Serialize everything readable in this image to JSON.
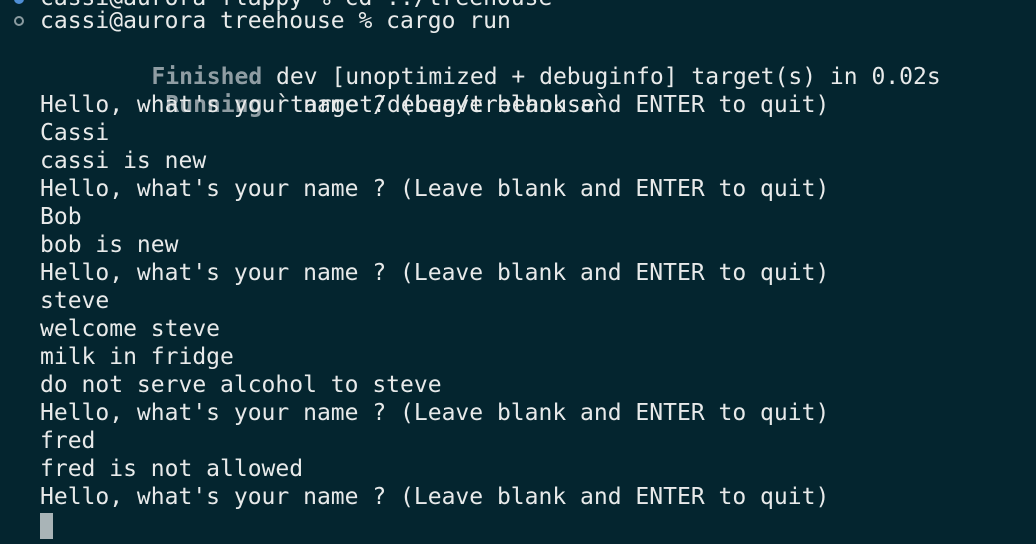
{
  "prompt_cut": {
    "text": "cassi@aurora flappy % cd ../treehouse"
  },
  "prompt": {
    "text": "cassi@aurora treehouse % cargo run"
  },
  "build": {
    "finished_status": "Finished",
    "finished_detail": " dev [unoptimized + debuginfo] target(s) in 0.02s",
    "running_status": "Running",
    "running_detail": " `target/debug/treehouse`"
  },
  "output": [
    "Hello, what's your name ? (Leave blank and ENTER to quit)",
    "Cassi",
    "cassi is new",
    "Hello, what's your name ? (Leave blank and ENTER to quit)",
    "Bob",
    "bob is new",
    "Hello, what's your name ? (Leave blank and ENTER to quit)",
    "steve",
    "welcome steve",
    "milk in fridge",
    "do not serve alcohol to steve",
    "Hello, what's your name ? (Leave blank and ENTER to quit)",
    "fred",
    "fred is not allowed",
    "Hello, what's your name ? (Leave blank and ENTER to quit)"
  ]
}
